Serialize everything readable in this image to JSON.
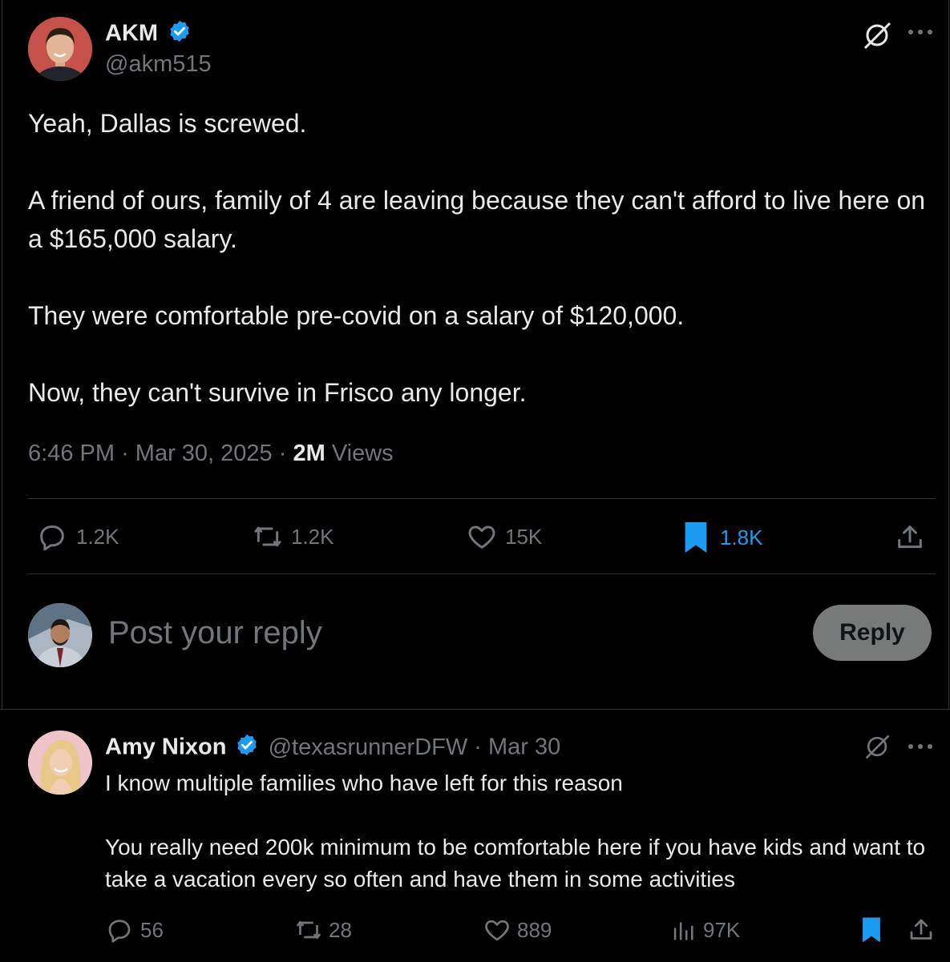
{
  "main_post": {
    "author_name": "AKM",
    "author_handle": "@akm515",
    "body": "Yeah, Dallas is screwed.\n\nA friend of ours, family of 4 are leaving because they can't afford to live here on a $165,000 salary.\n\nThey were comfortable pre-covid on a salary of $120,000.\n\nNow, they can't survive in Frisco any longer.",
    "time": "6:46 PM",
    "date": "Mar 30, 2025",
    "views_count": "2M",
    "views_label": "Views",
    "metrics": {
      "replies": "1.2K",
      "reposts": "1.2K",
      "likes": "15K",
      "bookmarks": "1.8K"
    },
    "icons": [
      "grok-icon",
      "more-icon",
      "verified-icon",
      "reply-icon",
      "repost-icon",
      "like-icon",
      "bookmark-icon",
      "share-icon"
    ]
  },
  "composer": {
    "placeholder": "Post your reply",
    "button_label": "Reply"
  },
  "reply_post": {
    "author_name": "Amy Nixon",
    "author_handle": "@texasrunnerDFW",
    "date": "Mar 30",
    "body_line1": "I know multiple families who have left for this reason",
    "body_line2": "You really need 200k minimum to be comfortable here if you have kids and want to take a vacation every so often and have them in some activities",
    "metrics": {
      "replies": "56",
      "reposts": "28",
      "likes": "889",
      "views": "97K"
    }
  },
  "colors": {
    "background": "#000000",
    "text": "#e7e9ea",
    "muted": "#71767b",
    "accent": "#1d9bf0",
    "divider": "#2f3336",
    "reply_button_bg": "#787a7a"
  }
}
